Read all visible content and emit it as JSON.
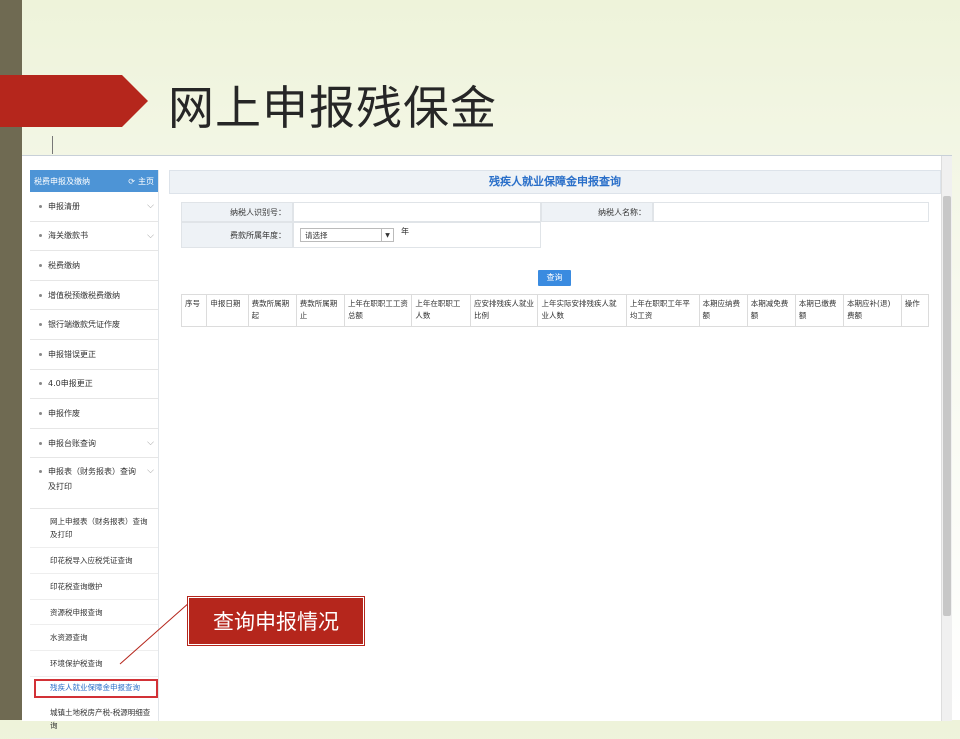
{
  "slide": {
    "title": "网上申报残保金",
    "callout": "查询申报情况"
  },
  "sidebar": {
    "header": "税费申报及缴纳",
    "home_label": "主页",
    "items": [
      {
        "label": "申报清册",
        "has_chevron": true
      },
      {
        "label": "海关缴款书",
        "has_chevron": true
      },
      {
        "label": "税费缴纳",
        "has_chevron": false
      },
      {
        "label": "增值税预缴税费缴纳",
        "has_chevron": false
      },
      {
        "label": "银行端缴款凭证作废",
        "has_chevron": false
      },
      {
        "label": "申报错误更正",
        "has_chevron": false
      },
      {
        "label": "4.0申报更正",
        "has_chevron": false
      },
      {
        "label": "申报作废",
        "has_chevron": false
      },
      {
        "label": "申报台账查询",
        "has_chevron": true
      },
      {
        "label": "申报表（财务报表）查询及打印",
        "has_chevron": true
      }
    ],
    "subitems": [
      "网上申报表（财务报表）查询及打印",
      "印花税导入应税凭证查询",
      "印花税查询缴护",
      "资源税申报查询",
      "水资源查询",
      "环境保护税查询",
      "残疾人就业保障金申报查询",
      "城镇土地税房产税-税源明细查询"
    ],
    "active_subitem": "残疾人就业保障金申报查询"
  },
  "main": {
    "title": "残疾人就业保障金申报查询",
    "form": {
      "taxpayer_id_label": "纳税人识别号：",
      "taxpayer_id_value": "",
      "taxpayer_name_label": "纳税人名称：",
      "taxpayer_name_value": "",
      "year_label": "费款所属年度：",
      "year_select": "请选择",
      "year_unit": "年"
    },
    "query_button": "查询",
    "table_headers": [
      "序号",
      "申报日期",
      "费款所属期起",
      "费款所属期止",
      "上年在职职工工资总额",
      "上年在职职工人数",
      "应安排残疾人就业比例",
      "上年实际安排残疾人就业人数",
      "上年在职职工年平均工资",
      "本期应纳费额",
      "本期减免费额",
      "本期已缴费额",
      "本期应补(退)费额",
      "操作"
    ]
  }
}
